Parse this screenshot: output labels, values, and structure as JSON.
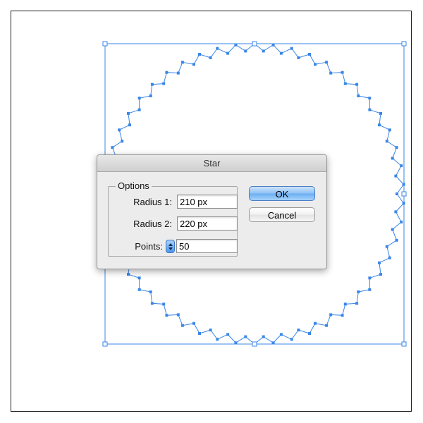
{
  "dialog": {
    "title": "Star",
    "options_legend": "Options",
    "fields": {
      "radius1_label": "Radius 1:",
      "radius1_value": "210 px",
      "radius2_label": "Radius 2:",
      "radius2_value": "220 px",
      "points_label": "Points:",
      "points_value": "50"
    },
    "ok_label": "OK",
    "cancel_label": "Cancel"
  },
  "canvas": {
    "selection_color": "#3a86e8",
    "artboard_border_color": "#1a1a1a",
    "star_points": 50
  },
  "icons": {
    "stepper": "stepper-up-down-icon"
  }
}
